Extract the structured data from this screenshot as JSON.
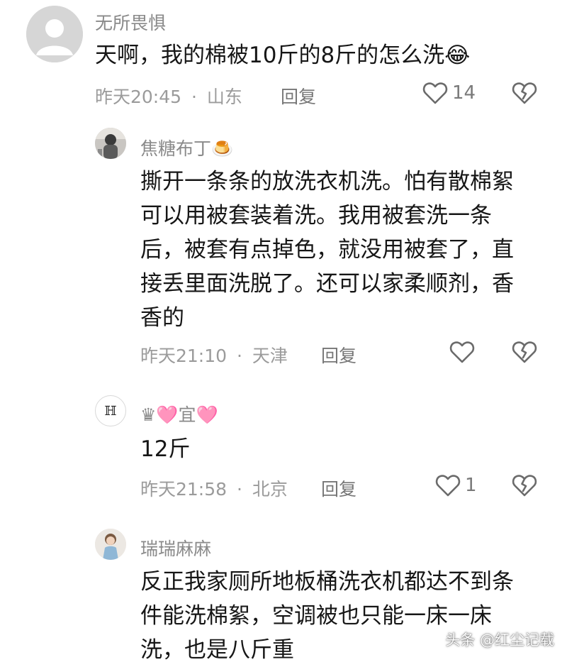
{
  "comments": [
    {
      "username": "无所畏惧",
      "text_lines": [
        "天啊，我的棉被10斤的8斤的怎么洗"
      ],
      "emoji": "😂",
      "time": "昨天20:45",
      "sep": "·",
      "location": "山东",
      "reply_label": "回复",
      "like_count": "14"
    },
    {
      "username": "焦糖布丁",
      "name_emoji": "🍮",
      "text_lines": [
        "撕开一条条的放洗衣机洗。怕有散棉絮",
        "可以用被套装着洗。我用被套洗一条",
        "后，被套有点掉色，就没用被套了，直",
        "接丢里面洗脱了。还可以家柔顺剂，香",
        "香的"
      ],
      "time": "昨天21:10",
      "sep": "·",
      "location": "天津",
      "reply_label": "回复",
      "like_count": ""
    },
    {
      "username": "♛🩷宜🩷",
      "text_lines": [
        "12斤"
      ],
      "time": "昨天21:58",
      "sep": "·",
      "location": "北京",
      "reply_label": "回复",
      "like_count": "1"
    },
    {
      "username": "瑞瑞麻麻",
      "text_lines": [
        "反正我家厕所地板桶洗衣机都达不到条",
        "件能洗棉絮，空调被也只能一床一床",
        "洗，也是八斤重"
      ]
    }
  ],
  "avatar3_glyph": "ℍ",
  "watermark": "头条 @红尘记载",
  "colors": {
    "text": "#161616",
    "muted": "#9b9b9b",
    "avatar_bg": "#d4d4d4"
  }
}
